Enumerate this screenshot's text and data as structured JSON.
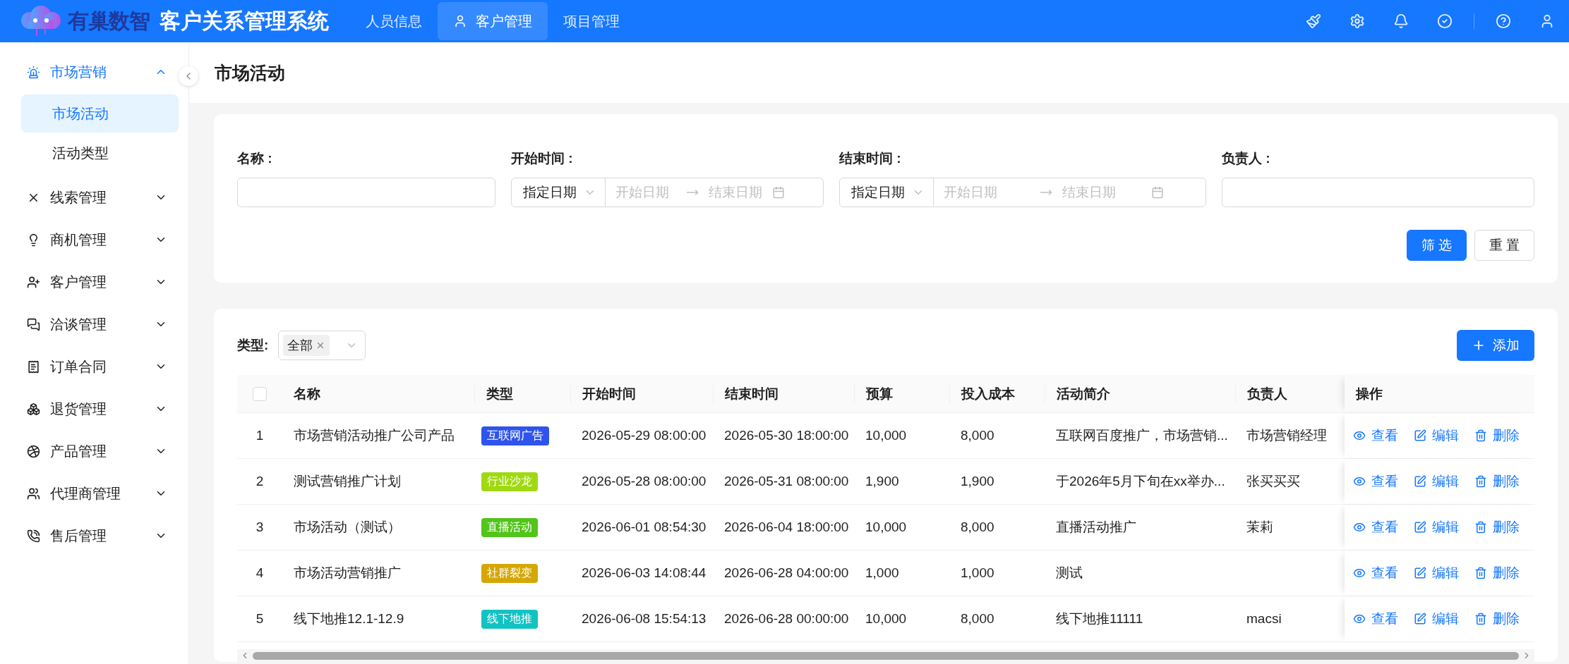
{
  "header": {
    "logo_text": "有巢数智",
    "title": "客户关系管理系统",
    "nav": [
      {
        "label": "人员信息",
        "selected": false,
        "has_icon": false
      },
      {
        "label": "客户管理",
        "selected": true,
        "has_icon": true
      },
      {
        "label": "项目管理",
        "selected": false,
        "has_icon": false
      }
    ]
  },
  "sidebar": {
    "items": [
      {
        "label": "市场营销",
        "expanded": true,
        "children": [
          {
            "label": "市场活动",
            "selected": true
          },
          {
            "label": "活动类型",
            "selected": false
          }
        ]
      },
      {
        "label": "线索管理",
        "expanded": false
      },
      {
        "label": "商机管理",
        "expanded": false
      },
      {
        "label": "客户管理",
        "expanded": false
      },
      {
        "label": "洽谈管理",
        "expanded": false
      },
      {
        "label": "订单合同",
        "expanded": false
      },
      {
        "label": "退货管理",
        "expanded": false
      },
      {
        "label": "产品管理",
        "expanded": false
      },
      {
        "label": "代理商管理",
        "expanded": false
      },
      {
        "label": "售后管理",
        "expanded": false
      }
    ]
  },
  "page_title": "市场活动",
  "filters": {
    "fields": [
      {
        "kind": "text",
        "label": "名称 :"
      },
      {
        "kind": "date_range",
        "label": "开始时间 :",
        "mode": "指定日期",
        "start_placeholder": "开始日期",
        "end_placeholder": "结束日期"
      },
      {
        "kind": "date_range",
        "label": "结束时间 :",
        "mode": "指定日期",
        "start_placeholder": "开始日期",
        "end_placeholder": "结束日期"
      },
      {
        "kind": "text",
        "label": "负责人 :"
      }
    ],
    "buttons": [
      {
        "label": "筛 选",
        "kind": "primary"
      },
      {
        "label": "重 置",
        "kind": "default"
      }
    ]
  },
  "toolbar": {
    "type_label": "类型:",
    "type_tag": "全部",
    "add_button": "添加"
  },
  "table": {
    "select_all": {
      "checked": false
    },
    "columns": [
      "名称",
      "类型",
      "开始时间",
      "结束时间",
      "预算",
      "投入成本",
      "活动简介",
      "负责人",
      "操作"
    ],
    "rows": [
      {
        "index": "1",
        "name": "市场营销活动推广公司产品",
        "type": {
          "label": "互联网广告",
          "color": "#2f54eb"
        },
        "start": "2026-05-29 08:00:00",
        "end": "2026-05-30 18:00:00",
        "budget": "10,000",
        "cost": "8,000",
        "summary": "互联网百度推广，市场营销...",
        "owner": "市场营销经理",
        "actions": [
          "查看",
          "编辑",
          "删除"
        ]
      },
      {
        "index": "2",
        "name": "测试营销推广计划",
        "type": {
          "label": "行业沙龙",
          "color": "#a0d911"
        },
        "start": "2026-05-28 08:00:00",
        "end": "2026-05-31 08:00:00",
        "budget": "1,900",
        "cost": "1,900",
        "summary": "于2026年5月下旬在xx举办...",
        "owner": "张买买买",
        "actions": [
          "查看",
          "编辑",
          "删除"
        ]
      },
      {
        "index": "3",
        "name": "市场活动（测试）",
        "type": {
          "label": "直播活动",
          "color": "#52c41a"
        },
        "start": "2026-06-01 08:54:30",
        "end": "2026-06-04 18:00:00",
        "budget": "10,000",
        "cost": "8,000",
        "summary": "直播活动推广",
        "owner": "茉莉",
        "actions": [
          "查看",
          "编辑",
          "删除"
        ]
      },
      {
        "index": "4",
        "name": "市场活动营销推广",
        "type": {
          "label": "社群裂变",
          "color": "#d4a706"
        },
        "start": "2026-06-03 14:08:44",
        "end": "2026-06-28 04:00:00",
        "budget": "1,000",
        "cost": "1,000",
        "summary": "测试",
        "actions": [
          "查看",
          "编辑",
          "删除"
        ]
      },
      {
        "index": "5",
        "name": "线下地推12.1-12.9",
        "type": {
          "label": "线下地推",
          "color": "#13c2c2"
        },
        "start": "2026-06-08 15:54:13",
        "end": "2026-06-28 00:00:00",
        "budget": "10,000",
        "cost": "8,000",
        "summary": "线下地推11111",
        "owner": "macsi",
        "actions": [
          "查看",
          "编辑",
          "删除"
        ]
      }
    ]
  }
}
